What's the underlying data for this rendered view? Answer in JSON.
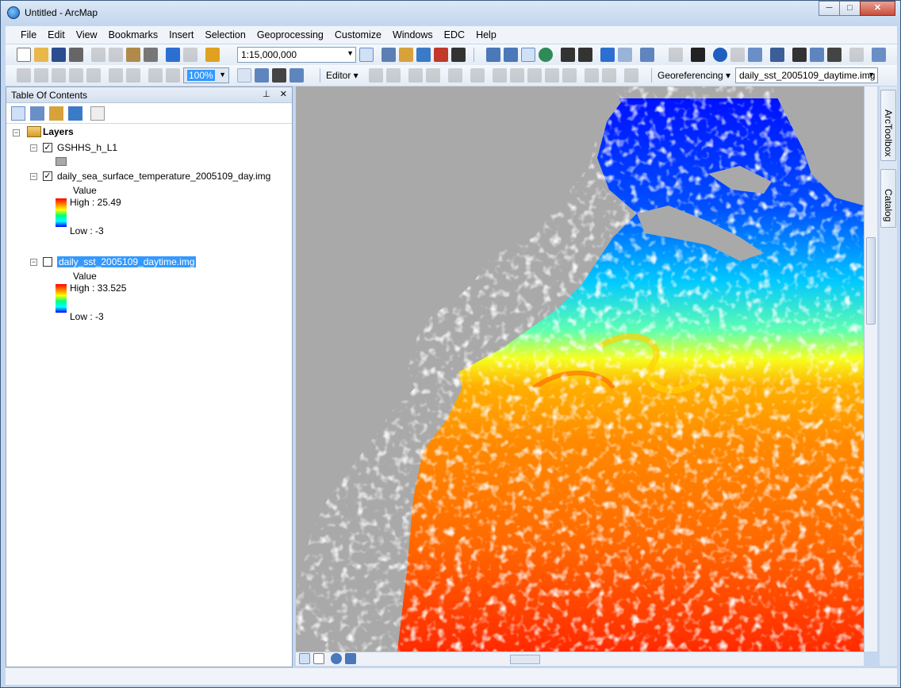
{
  "window": {
    "title": "Untitled - ArcMap",
    "minimize": "─",
    "maximize": "□",
    "close": "✕"
  },
  "menu": [
    "File",
    "Edit",
    "View",
    "Bookmarks",
    "Insert",
    "Selection",
    "Geoprocessing",
    "Customize",
    "Windows",
    "EDC",
    "Help"
  ],
  "toolbar": {
    "scale": "1:15,000,000",
    "zoom_percent": "100%",
    "editor_label": "Editor ▾",
    "georeferencing_label": "Georeferencing ▾",
    "georef_layer": "daily_sst_2005109_daytime.img"
  },
  "toc": {
    "title": "Table Of Contents",
    "pin": "📌",
    "close": "✕",
    "root": "Layers",
    "layers": [
      {
        "name": "GSHHS_h_L1",
        "checked": true,
        "legend_type": "swatch",
        "swatch_color": "#a9a9a9"
      },
      {
        "name": "daily_sea_surface_temperature_2005109_day.img",
        "checked": true,
        "legend_type": "ramp",
        "value_label": "Value",
        "high_label": "High : 25.49",
        "low_label": "Low : -3"
      },
      {
        "name": "daily_sst_2005109_daytime.img",
        "checked": false,
        "selected": true,
        "legend_type": "ramp",
        "value_label": "Value",
        "high_label": "High : 33.525",
        "low_label": "Low : -3"
      }
    ]
  },
  "dock": {
    "arctoolbox": "ArcToolbox",
    "catalog": "Catalog"
  },
  "colors": {
    "land": "#a9a9a9",
    "selection": "#3399ff",
    "sst_warm": "#ff3000",
    "sst_cold": "#0000ff"
  }
}
